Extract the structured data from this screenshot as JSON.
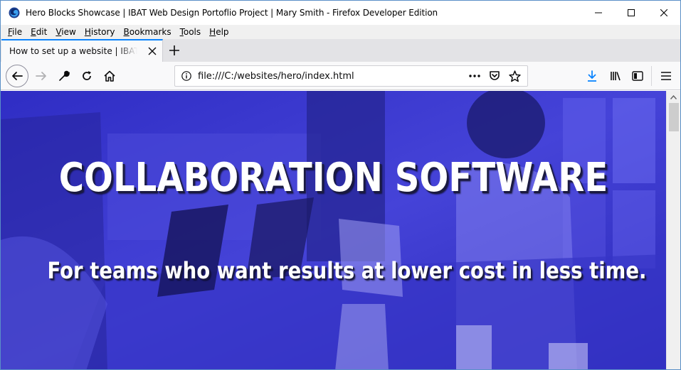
{
  "window": {
    "title": "Hero Blocks Showcase | IBAT Web Design Portoflio Project | Mary Smith - Firefox Developer Edition"
  },
  "menu": {
    "items": [
      {
        "accel": "F",
        "rest": "ile"
      },
      {
        "accel": "E",
        "rest": "dit"
      },
      {
        "accel": "V",
        "rest": "iew"
      },
      {
        "accel": "H",
        "rest": "istory"
      },
      {
        "accel": "B",
        "rest": "ookmarks"
      },
      {
        "accel": "T",
        "rest": "ools"
      },
      {
        "accel": "H",
        "rest": "elp"
      }
    ]
  },
  "tabs": [
    {
      "label": "How to set up a website | IBAT Portfolio"
    }
  ],
  "urlbar": {
    "url": "file:///C:/websites/hero/index.html"
  },
  "icons": {
    "app": "firefox-developer-icon",
    "minimize": "minimize-icon",
    "maximize": "maximize-icon",
    "close": "close-icon",
    "back": "back-arrow-icon",
    "forward": "forward-arrow-icon",
    "devtools": "wrench-icon",
    "reload": "reload-icon",
    "home": "home-icon",
    "info": "info-icon",
    "page_actions": "more-dots-icon",
    "pocket": "pocket-icon",
    "bookmark": "star-icon",
    "downloads": "download-arrow-icon",
    "library": "library-icon",
    "sidebar": "sidebar-icon",
    "menu": "hamburger-menu-icon"
  },
  "colors": {
    "accent": "#0a84ff",
    "hero_overlay": "#3d3bd0"
  },
  "hero": {
    "title": "COLLABORATION SOFTWARE",
    "subtitle": "For teams who want results at lower cost in less time."
  }
}
